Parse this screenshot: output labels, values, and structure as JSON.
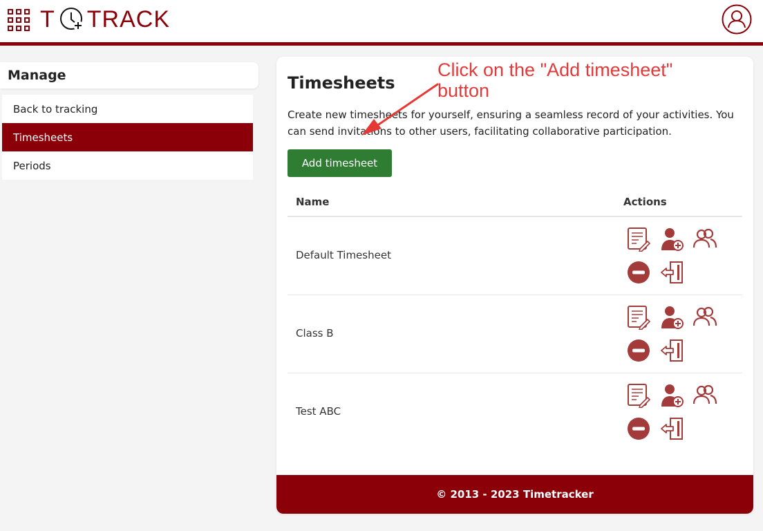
{
  "header": {
    "logo_left": "T",
    "logo_right": "TRACK"
  },
  "sidebar": {
    "title": "Manage",
    "items": [
      {
        "label": "Back to tracking",
        "active": false
      },
      {
        "label": "Timesheets",
        "active": true
      },
      {
        "label": "Periods",
        "active": false
      }
    ]
  },
  "main": {
    "title": "Timesheets",
    "description": "Create new timesheets for yourself, ensuring a seamless record of your activities. You can send invitations to other users, facilitating collaborative participation.",
    "add_button": "Add timesheet",
    "table": {
      "headers": {
        "name": "Name",
        "actions": "Actions"
      },
      "rows": [
        {
          "name": "Default Timesheet"
        },
        {
          "name": "Class B"
        },
        {
          "name": "Test ABC"
        }
      ]
    },
    "footer": "© 2013 - 2023 Timetracker"
  },
  "annotation": {
    "text": "Click on the \"Add timesheet\" button"
  },
  "colors": {
    "brand": "#8b0008",
    "button_green": "#2e7d32",
    "icon": "#a33b3b",
    "annotation": "#e03a3a"
  },
  "icons": {
    "row_actions": [
      "edit-icon",
      "add-user-icon",
      "users-icon",
      "remove-icon",
      "leave-icon"
    ]
  }
}
